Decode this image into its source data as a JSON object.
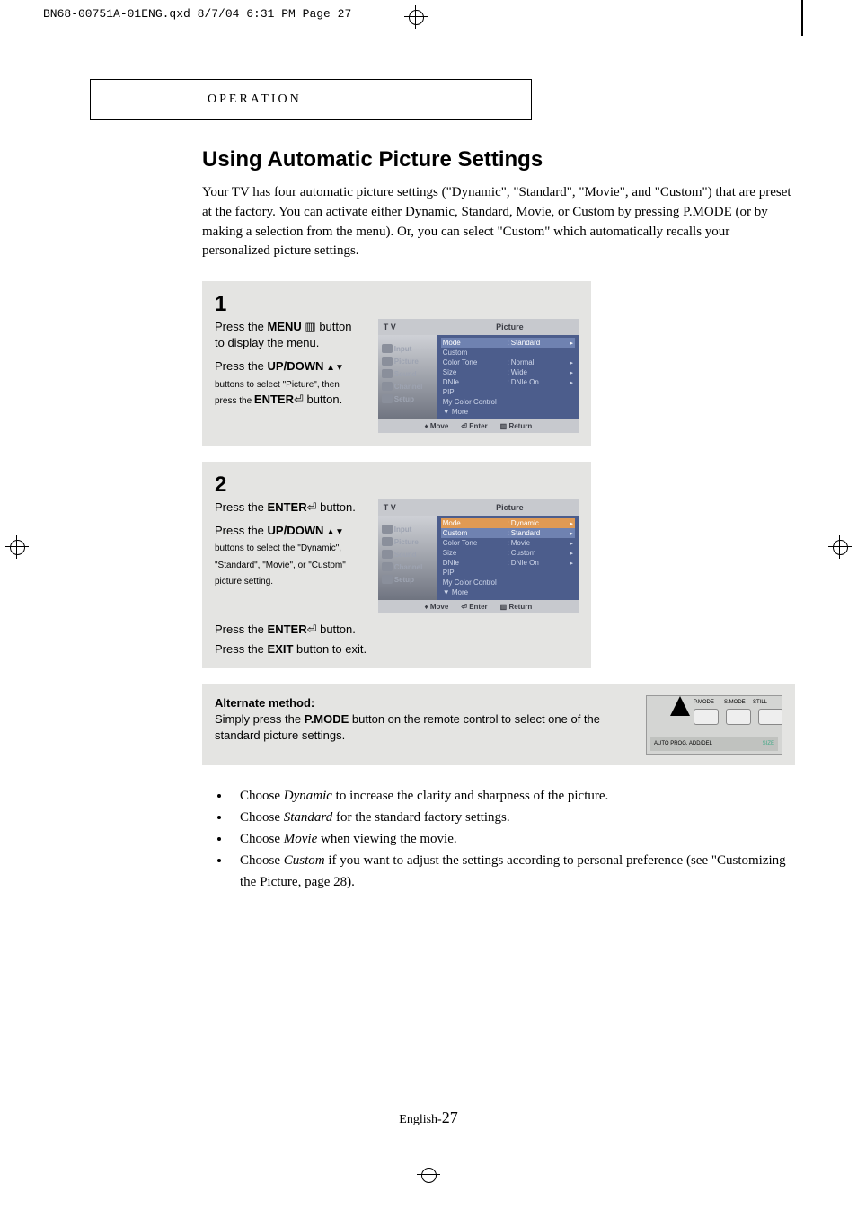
{
  "meta": {
    "header": "BN68-00751A-01ENG.qxd  8/7/04 6:31 PM  Page 27"
  },
  "section": {
    "label": "OPERATION"
  },
  "title": "Using Automatic Picture Settings",
  "intro": "Your TV has four automatic picture settings (\"Dynamic\", \"Standard\", \"Movie\", and \"Custom\") that are preset at the factory. You can activate either Dynamic, Standard, Movie, or Custom by pressing P.MODE (or by making a selection from the menu). Or, you can select \"Custom\" which automatically recalls your personalized picture settings.",
  "steps": {
    "s1": {
      "num": "1",
      "p1a": "Press the ",
      "p1b": "MENU",
      "p1c": " ▥ button to display the menu.",
      "p2a": "Press the ",
      "p2b": "UP/DOWN",
      "p2c": " ▲▼ buttons to select \"Picture\", then press the ",
      "p2d": "ENTER",
      "p2e": "⏎ button."
    },
    "s2": {
      "num": "2",
      "p1a": "Press the ",
      "p1b": "ENTER",
      "p1c": "⏎ button.",
      "p2a": "Press the ",
      "p2b": "UP/DOWN",
      "p2c": " ▲▼ buttons to select the \"Dynamic\", \"Standard\", \"Movie\", or \"Custom\" picture setting.",
      "p3a": "Press the ",
      "p3b": "ENTER",
      "p3c": "⏎ button.",
      "p4a": "Press the ",
      "p4b": "EXIT",
      "p4c": " button to exit."
    }
  },
  "osd": {
    "tv": "T V",
    "title": "Picture",
    "side": [
      "Input",
      "Picture",
      "Sound",
      "Channel",
      "Setup"
    ],
    "rows1": [
      {
        "k": "Mode",
        "v": "Standard",
        "sel": true
      },
      {
        "k": "Custom",
        "v": ""
      },
      {
        "k": "Color Tone",
        "v": "Normal"
      },
      {
        "k": "Size",
        "v": "Wide"
      },
      {
        "k": "DNIe",
        "v": "DNIe On"
      },
      {
        "k": "PIP",
        "v": ""
      },
      {
        "k": "My Color Control",
        "v": ""
      },
      {
        "k": "▼ More",
        "v": ""
      }
    ],
    "rows2": [
      {
        "k": "Mode",
        "v": "Dynamic",
        "hl": true
      },
      {
        "k": "Custom",
        "v": "Standard",
        "sel": true
      },
      {
        "k": "Color Tone",
        "v": "Movie"
      },
      {
        "k": "Size",
        "v": "Custom"
      },
      {
        "k": "DNIe",
        "v": "DNIe On"
      },
      {
        "k": "PIP",
        "v": ""
      },
      {
        "k": "My Color Control",
        "v": ""
      },
      {
        "k": "▼ More",
        "v": ""
      }
    ],
    "foot": {
      "move": "♦ Move",
      "enter": "⏎ Enter",
      "return": "▥ Return"
    }
  },
  "alt": {
    "head": "Alternate method:",
    "body1": "Simply press the ",
    "body2": "P.MODE",
    "body3": " button on the remote control to select one of the standard picture settings."
  },
  "remote": {
    "b1": "P.MODE",
    "b2": "S.MODE",
    "b3": "STILL",
    "bl": "AUTO PROG.  ADD/DEL",
    "br": "SIZE"
  },
  "bullets": {
    "i1a": "Choose ",
    "i1b": "Dynamic",
    "i1c": " to increase the clarity and sharpness of the picture.",
    "i2a": "Choose ",
    "i2b": "Standard",
    "i2c": " for the standard factory settings.",
    "i3a": "Choose ",
    "i3b": "Movie",
    "i3c": " when viewing the movie.",
    "i4a": "Choose ",
    "i4b": "Custom",
    "i4c": " if you want to adjust the settings according to personal preference (see \"Customizing the Picture, page 28)."
  },
  "footer": {
    "lang": "English-",
    "page": "27"
  }
}
